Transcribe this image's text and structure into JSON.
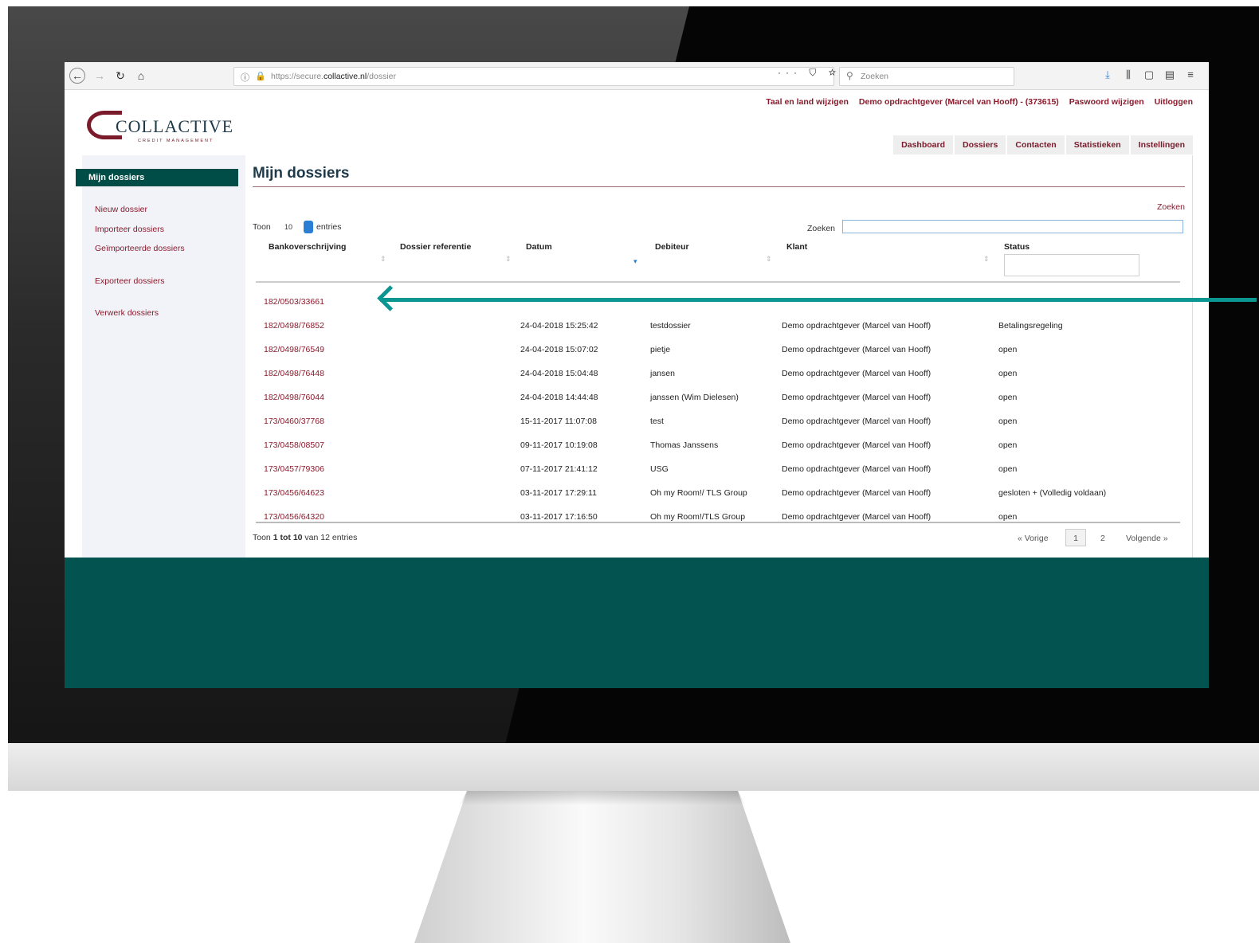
{
  "browser": {
    "url_prefix": "https://secure.",
    "url_domain": "collactive.nl",
    "url_path": "/dossier",
    "search_placeholder": "Zoeken",
    "url_tools": "··· ⛉ ☆"
  },
  "header": {
    "links": [
      "Taal en land wijzigen",
      "Demo opdrachtgever (Marcel van Hooff) - (373615)",
      "Paswoord wijzigen",
      "Uitloggen"
    ],
    "logo_main": "COLLACTIVE",
    "logo_sub": "CREDIT MANAGEMENT",
    "nav": [
      "Dashboard",
      "Dossiers",
      "Contacten",
      "Statistieken",
      "Instellingen"
    ]
  },
  "sidebar": {
    "active": "Mijn dossiers",
    "items": [
      "Nieuw dossier",
      "Importeer dossiers",
      "Geïmporteerde dossiers",
      "Exporteer dossiers",
      "Verwerk dossiers"
    ]
  },
  "main": {
    "title": "Mijn dossiers",
    "search_link": "Zoeken",
    "show_label": "Toon",
    "show_value": "10",
    "entries_label": "entries",
    "search_label": "Zoeken",
    "columns": [
      "Bankoverschrijving",
      "Dossier referentie",
      "Datum",
      "Debiteur",
      "Klant",
      "Status"
    ],
    "rows": [
      {
        "bank": "182/0503/33661",
        "datum": "",
        "debiteur": "",
        "klant": "",
        "status": ""
      },
      {
        "bank": "182/0498/76852",
        "datum": "24-04-2018 15:25:42",
        "debiteur": "testdossier",
        "klant": "Demo opdrachtgever (Marcel van Hooff)",
        "status": "Betalingsregeling"
      },
      {
        "bank": "182/0498/76549",
        "datum": "24-04-2018 15:07:02",
        "debiteur": "pietje",
        "klant": "Demo opdrachtgever (Marcel van Hooff)",
        "status": "open"
      },
      {
        "bank": "182/0498/76448",
        "datum": "24-04-2018 15:04:48",
        "debiteur": "jansen",
        "klant": "Demo opdrachtgever (Marcel van Hooff)",
        "status": "open"
      },
      {
        "bank": "182/0498/76044",
        "datum": "24-04-2018 14:44:48",
        "debiteur": "janssen (Wim Dielesen)",
        "klant": "Demo opdrachtgever (Marcel van Hooff)",
        "status": "open"
      },
      {
        "bank": "173/0460/37768",
        "datum": "15-11-2017 11:07:08",
        "debiteur": "test",
        "klant": "Demo opdrachtgever (Marcel van Hooff)",
        "status": "open"
      },
      {
        "bank": "173/0458/08507",
        "datum": "09-11-2017 10:19:08",
        "debiteur": "Thomas Janssens",
        "klant": "Demo opdrachtgever (Marcel van Hooff)",
        "status": "open"
      },
      {
        "bank": "173/0457/79306",
        "datum": "07-11-2017 21:41:12",
        "debiteur": "USG",
        "klant": "Demo opdrachtgever (Marcel van Hooff)",
        "status": "open"
      },
      {
        "bank": "173/0456/64623",
        "datum": "03-11-2017 17:29:11",
        "debiteur": "Oh my Room!/ TLS Group",
        "klant": "Demo opdrachtgever (Marcel van Hooff)",
        "status": "gesloten + (Volledig voldaan)"
      },
      {
        "bank": "173/0456/64320",
        "datum": "03-11-2017 17:16:50",
        "debiteur": "Oh my Room!/TLS Group",
        "klant": "Demo opdrachtgever (Marcel van Hooff)",
        "status": "open"
      }
    ],
    "info": {
      "prefix": "Toon",
      "from": "1",
      "mid": "tot",
      "to": "10",
      "suffix": "van 12 entries"
    },
    "pagination": {
      "prev": "« Vorige",
      "current": "1",
      "next_page": "2",
      "next": "Volgende »"
    }
  },
  "colors": {
    "accent": "#8b1a2c",
    "sidebar_active": "#004c46",
    "annotation_arrow": "#0c9691"
  }
}
